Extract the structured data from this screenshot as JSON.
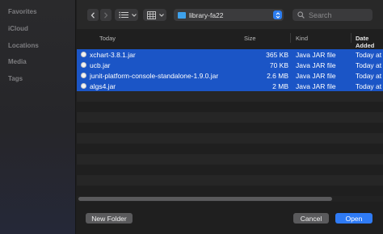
{
  "sidebar": {
    "sections": [
      "Favorites",
      "iCloud",
      "Locations",
      "Media",
      "Tags"
    ]
  },
  "toolbar": {
    "back_icon": "chevron-left-icon",
    "forward_icon": "chevron-right-icon",
    "list_view_icon": "list-icon",
    "grid_view_icon": "grid-icon",
    "location": "library-fa22",
    "search_placeholder": "Search"
  },
  "table": {
    "headers": [
      "Today",
      "Size",
      "Kind",
      "Date Added"
    ],
    "rows": [
      {
        "name": "xchart-3.8.1.jar",
        "size": "365 KB",
        "kind": "Java JAR file",
        "date": "Today at"
      },
      {
        "name": "ucb.jar",
        "size": "70 KB",
        "kind": "Java JAR file",
        "date": "Today at"
      },
      {
        "name": "junit-platform-console-standalone-1.9.0.jar",
        "size": "2.6 MB",
        "kind": "Java JAR file",
        "date": "Today at"
      },
      {
        "name": "algs4.jar",
        "size": "2 MB",
        "kind": "Java JAR file",
        "date": "Today at"
      }
    ]
  },
  "footer": {
    "new_folder": "New Folder",
    "cancel": "Cancel",
    "open": "Open"
  },
  "colors": {
    "selection": "#1b55c6",
    "accent": "#2f7bf5"
  }
}
